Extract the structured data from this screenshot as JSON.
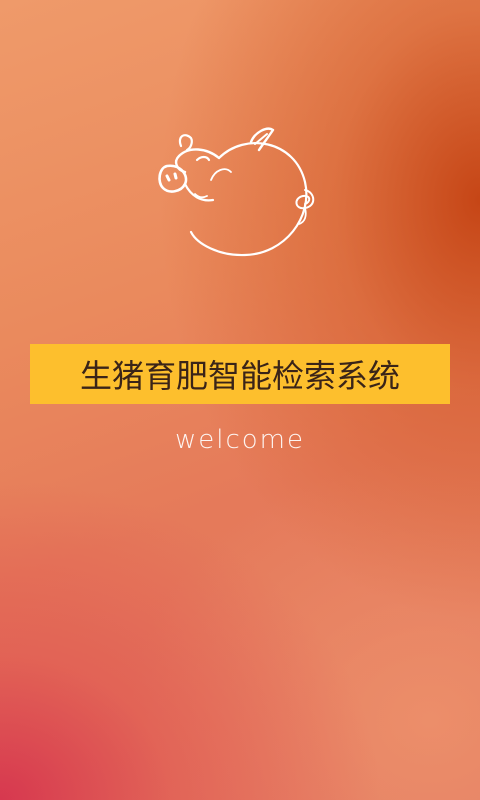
{
  "splash": {
    "title": "生猪育肥智能检索系统",
    "welcome_text": "welcome",
    "logo_icon": "pig-icon"
  },
  "colors": {
    "banner": "#fdbf2d",
    "title_text": "#3a2418",
    "welcome_text": "#ffffff",
    "bg_orange": "#ea8a5d",
    "bg_dark_orange": "#c44212",
    "bg_red": "#d6344e"
  }
}
